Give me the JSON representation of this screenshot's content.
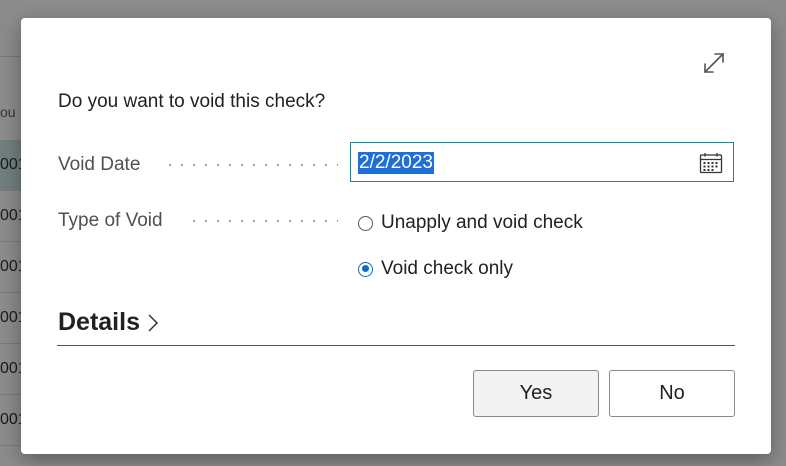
{
  "background": {
    "column_label": "ou",
    "rows": [
      "001",
      "001",
      "001",
      "001",
      "001",
      "001"
    ]
  },
  "dialog": {
    "prompt": "Do you want to void this check?",
    "void_date": {
      "label": "Void Date",
      "value": "2/2/2023",
      "icon": "calendar-icon"
    },
    "type_of_void": {
      "label": "Type of Void",
      "options": [
        {
          "label": "Unapply and void check",
          "selected": false
        },
        {
          "label": "Void check only",
          "selected": true
        }
      ]
    },
    "details_label": "Details",
    "buttons": {
      "yes": "Yes",
      "no": "No"
    },
    "expand_icon": "expand-icon"
  },
  "colors": {
    "accent": "#0f6cbd",
    "input_border": "#2a7f8a",
    "selected_row": "#cfe7e9",
    "text_selection": "#1f6fd6"
  }
}
